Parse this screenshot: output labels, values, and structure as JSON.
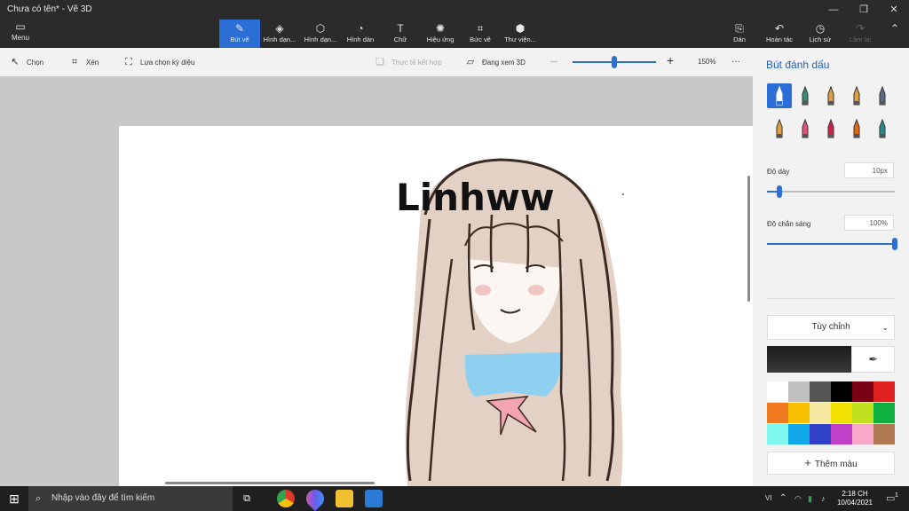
{
  "window": {
    "title": "Chưa có tên* - Vẽ 3D",
    "controls": [
      "minimize-icon",
      "maximize-icon",
      "close-icon"
    ]
  },
  "ribbon": {
    "menu_label": "Menu",
    "tools": [
      {
        "label": "Bút vẽ",
        "icon": "brush-icon",
        "active": true
      },
      {
        "label": "Hình dạn...",
        "icon": "2d-shapes-icon"
      },
      {
        "label": "Hình dạn...",
        "icon": "3d-shapes-icon"
      },
      {
        "label": "Hình dán",
        "icon": "stickers-icon"
      },
      {
        "label": "Chữ",
        "icon": "text-icon"
      },
      {
        "label": "Hiệu ứng",
        "icon": "effects-icon"
      },
      {
        "label": "Bức vẽ",
        "icon": "canvas-icon"
      },
      {
        "label": "Thư viện...",
        "icon": "library-icon"
      }
    ],
    "right_tools": [
      {
        "label": "Dán",
        "icon": "paste-icon"
      },
      {
        "label": "Hoàn tác",
        "icon": "undo-icon"
      },
      {
        "label": "Lịch sử",
        "icon": "history-icon"
      },
      {
        "label": "Làm lại",
        "icon": "redo-icon",
        "disabled": true
      }
    ]
  },
  "subtoolbar": {
    "select": "Chọn",
    "crop": "Xén",
    "magic_select": "Lựa chọn kỳ diệu",
    "mixed_reality": "Thực tế kết hợp",
    "view_3d": "Đang xem 3D",
    "zoom_minus": "—",
    "zoom_plus": "+",
    "zoom_fraction": 0.5,
    "zoom_level": "150%",
    "more": "···"
  },
  "canvas": {
    "drawing_text": "Linhww"
  },
  "side_panel": {
    "heading": "Bút đánh dấu",
    "brushes": [
      {
        "icon": "marker-icon",
        "color": "#2b6fd6",
        "selected": true
      },
      {
        "icon": "calligraphy-pen-icon",
        "color": "#3a8a7a"
      },
      {
        "icon": "oil-brush-icon",
        "color": "#e0a040"
      },
      {
        "icon": "watercolor-icon",
        "color": "#e0a040"
      },
      {
        "icon": "pixel-pen-icon",
        "color": "#5a6a8a"
      },
      {
        "icon": "pencil-icon",
        "color": "#e0a040"
      },
      {
        "icon": "eraser-icon",
        "color": "#e0507a"
      },
      {
        "icon": "crayon-icon",
        "color": "#d02050"
      },
      {
        "icon": "spray-can-icon",
        "color": "#e06a10"
      },
      {
        "icon": "fill-icon",
        "color": "#2a8a8a"
      }
    ],
    "thickness_label": "Độ dày",
    "thickness_value": "10px",
    "thickness_fraction": 0.1,
    "opacity_label": "Độ chắn sáng",
    "opacity_value": "100%",
    "opacity_fraction": 1.0,
    "mode_label": "Tùy chỉnh",
    "current_color": "#1f1f1f",
    "palette": [
      "#ffffff",
      "#c0c0c0",
      "#555555",
      "#000000",
      "#7a0014",
      "#e02020",
      "#f07a20",
      "#f8c000",
      "#f6e8a0",
      "#f0e000",
      "#c0e020",
      "#10b040",
      "#80f8f0",
      "#10a8e8",
      "#3040c8",
      "#c040c8",
      "#f8a8c8",
      "#b07850"
    ],
    "add_color": "Thêm màu"
  },
  "taskbar": {
    "search_placeholder": "Nhập vào đây để tìm kiếm",
    "apps": [
      {
        "icon": "task-view-icon"
      },
      {
        "icon": "chrome-icon",
        "color": "#e0392b"
      },
      {
        "icon": "paint-3d-icon",
        "color": "#6a5af0"
      },
      {
        "icon": "file-explorer-icon",
        "color": "#f0c030"
      },
      {
        "icon": "photos-icon",
        "color": "#2b7ad6"
      }
    ],
    "lang": "VI",
    "time": "2:18 CH",
    "date": "10/04/2021",
    "notification_count": "1"
  }
}
